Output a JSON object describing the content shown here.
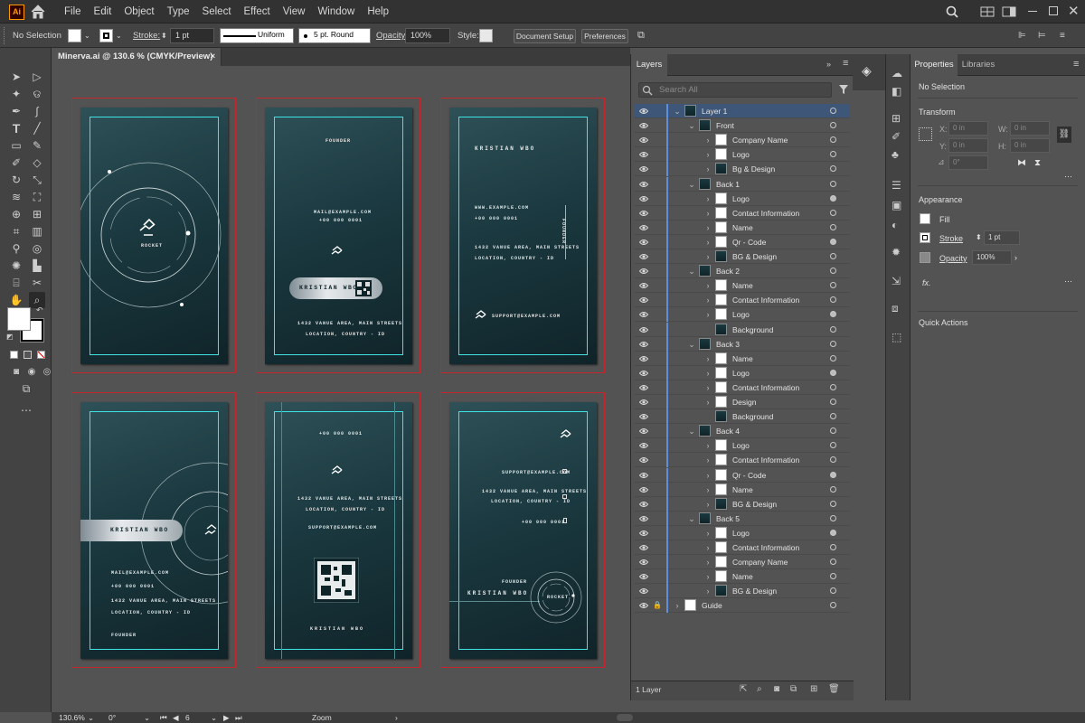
{
  "app": {
    "logo": "Ai"
  },
  "menu": [
    "File",
    "Edit",
    "Object",
    "Type",
    "Select",
    "Effect",
    "View",
    "Window",
    "Help"
  ],
  "control": {
    "selection": "No Selection",
    "stroke_label": "Stroke:",
    "stroke_value": "1 pt",
    "stroke_profile": "Uniform",
    "brush": "5 pt. Round",
    "opacity_label": "Opacity:",
    "opacity_value": "100%",
    "style_label": "Style:",
    "document_setup": "Document Setup",
    "preferences": "Preferences"
  },
  "document": {
    "tab_title": "Minerva.ai @ 130.6 % (CMYK/Preview)",
    "close": "×"
  },
  "cards": {
    "c1": {
      "brand": "ROCKET"
    },
    "c2": {
      "role": "FOUNDER",
      "email": "MAIL@EXAMPLE.COM",
      "phone": "+00 000 0001",
      "name": "KRISTIAN WBO",
      "addr1": "1432 VANUE AREA, MAIN STREETS",
      "addr2": "LOCATION, COUNTRY - ID"
    },
    "c3": {
      "name": "KRISTIAN WBO",
      "web": "WWW.EXAMPLE.COM",
      "phone": "+00 000 0001",
      "addr1": "1432 VANUE AREA, MAIN STREETS",
      "addr2": "LOCATION, COUNTRY - ID",
      "side": "FOUNDER",
      "support": "SUPPORT@EXAMPLE.COM"
    },
    "c4": {
      "name": "KRISTIAN WBO",
      "email": "MAIL@EXAMPLE.COM",
      "phone": "+00 000 0001",
      "addr1": "1432 VANUE AREA, MAIN STREETS",
      "addr2": "LOCATION, COUNTRY - ID",
      "role": "FOUNDER"
    },
    "c5": {
      "phone": "+00 000 0001",
      "addr1": "1432 VANUE AREA, MAIN STREETS",
      "addr2": "LOCATION, COUNTRY - ID",
      "support": "SUPPORT@EXAMPLE.COM",
      "name": "KRISTIAN WBO"
    },
    "c6": {
      "support": "SUPPORT@EXAMPLE.COM",
      "addr1": "1432 VANUE AREA, MAIN STREETS",
      "addr2": "LOCATION, COUNTRY - ID",
      "phone": "+00 000 0001",
      "role": "FOUNDER",
      "name": "KRISTIAN WBO",
      "brand": "ROCKET"
    }
  },
  "layers": {
    "tab": "Layers",
    "search_placeholder": "Search All",
    "rows": [
      {
        "label": "Layer 1",
        "depth": 0,
        "open": true,
        "dark": true,
        "sel": true,
        "tgt": false
      },
      {
        "label": "Front",
        "depth": 1,
        "open": true,
        "dark": true,
        "tgt": false
      },
      {
        "label": "Company Name",
        "depth": 2,
        "tgt": false
      },
      {
        "label": "Logo",
        "depth": 2,
        "tgt": false
      },
      {
        "label": "Bg & Design",
        "depth": 2,
        "dark": true,
        "tgt": false
      },
      {
        "label": "Back 1",
        "depth": 1,
        "open": true,
        "dark": true,
        "tgt": false
      },
      {
        "label": "Logo",
        "depth": 2,
        "tgt": true
      },
      {
        "label": "Contact Information",
        "depth": 2,
        "tgt": false
      },
      {
        "label": "Name",
        "depth": 2,
        "tgt": false
      },
      {
        "label": "Qr - Code",
        "depth": 2,
        "tgt": true
      },
      {
        "label": "BG & Design",
        "depth": 2,
        "dark": true,
        "tgt": false
      },
      {
        "label": "Back 2",
        "depth": 1,
        "open": true,
        "dark": true,
        "tgt": false
      },
      {
        "label": "Name",
        "depth": 2,
        "tgt": false
      },
      {
        "label": "Contact Information",
        "depth": 2,
        "tgt": false
      },
      {
        "label": "Logo",
        "depth": 2,
        "tgt": true
      },
      {
        "label": "Background",
        "depth": 2,
        "dark": true,
        "noarrow": true,
        "tgt": false
      },
      {
        "label": "Back 3",
        "depth": 1,
        "open": true,
        "dark": true,
        "tgt": false
      },
      {
        "label": "Name",
        "depth": 2,
        "tgt": false
      },
      {
        "label": "Logo",
        "depth": 2,
        "tgt": true
      },
      {
        "label": "Contact Information",
        "depth": 2,
        "tgt": false
      },
      {
        "label": "Design",
        "depth": 2,
        "tgt": false
      },
      {
        "label": "Background",
        "depth": 2,
        "dark": true,
        "noarrow": true,
        "tgt": false
      },
      {
        "label": "Back 4",
        "depth": 1,
        "open": true,
        "dark": true,
        "tgt": false
      },
      {
        "label": "Logo",
        "depth": 2,
        "tgt": false
      },
      {
        "label": "Contact Information",
        "depth": 2,
        "tgt": false
      },
      {
        "label": "Qr - Code",
        "depth": 2,
        "tgt": true
      },
      {
        "label": "Name",
        "depth": 2,
        "tgt": false
      },
      {
        "label": "BG & Design",
        "depth": 2,
        "dark": true,
        "tgt": false
      },
      {
        "label": "Back 5",
        "depth": 1,
        "open": true,
        "dark": true,
        "tgt": false
      },
      {
        "label": "Logo",
        "depth": 2,
        "tgt": true
      },
      {
        "label": "Contact Information",
        "depth": 2,
        "tgt": false
      },
      {
        "label": "Company Name",
        "depth": 2,
        "tgt": false
      },
      {
        "label": "Name",
        "depth": 2,
        "tgt": false
      },
      {
        "label": "BG & Design",
        "depth": 2,
        "dark": true,
        "tgt": false
      },
      {
        "label": "Guide",
        "depth": 0,
        "locked": true,
        "tgt": false
      }
    ],
    "footer": "1 Layer"
  },
  "properties": {
    "tab": "Properties",
    "tab2": "Libraries",
    "selection": "No Selection",
    "transform": "Transform",
    "x_label": "X:",
    "x_value": "0 in",
    "y_label": "Y:",
    "y_value": "0 in",
    "w_label": "W:",
    "w_value": "0 in",
    "h_label": "H:",
    "h_value": "0 in",
    "angle_value": "0°",
    "appearance": "Appearance",
    "fill": "Fill",
    "stroke": "Stroke",
    "stroke_value": "1 pt",
    "opacity": "Opacity",
    "opacity_value": "100%",
    "fx": "fx.",
    "quick_actions": "Quick Actions"
  },
  "status": {
    "zoom": "130.6%",
    "angle": "0°",
    "artboard": "6",
    "tool": "Zoom"
  }
}
